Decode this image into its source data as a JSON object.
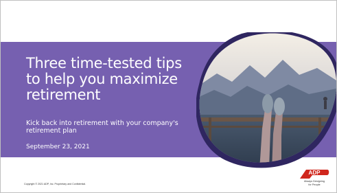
{
  "slide": {
    "title": "Three time-tested tips to help you maximize retirement",
    "subtitle": "Kick back into retirement with your company's retirement plan",
    "date": "September 23, 2021",
    "copyright": "Copyright © 2021  ADP, Inc. Proprietary and Confidential.",
    "logo": {
      "brand": "ADP",
      "tagline_line1": "Always Designing",
      "tagline_line2": "for People"
    },
    "photo_subject": "legs-on-railing-mountain-photo"
  },
  "colors": {
    "band": "#7660b0",
    "accent_dark": "#3a2f6b",
    "brand_red": "#d0271d"
  }
}
